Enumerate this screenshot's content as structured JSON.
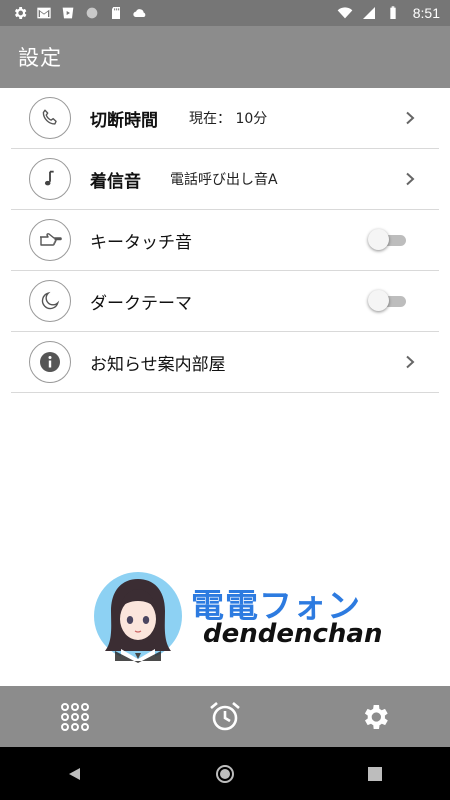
{
  "status_bar": {
    "time": "8:51",
    "left_icons": [
      "settings-icon",
      "gmail-icon",
      "play-icon",
      "circle-icon",
      "sd-card-icon",
      "cloud-icon"
    ],
    "right_icons": [
      "wifi-icon",
      "cellular-icon",
      "battery-icon"
    ]
  },
  "app_bar": {
    "title": "設定"
  },
  "settings": [
    {
      "icon": "phone-icon",
      "label": "切断時間",
      "value": "現在： 10分",
      "control": "chevron"
    },
    {
      "icon": "music-note-icon",
      "label": "着信音",
      "value": "電話呼び出し音A",
      "control": "chevron"
    },
    {
      "icon": "pointing-hand-icon",
      "label": "キータッチ音",
      "control": "toggle",
      "enabled": false
    },
    {
      "icon": "moon-icon",
      "label": "ダークテーマ",
      "control": "toggle",
      "enabled": false
    },
    {
      "icon": "info-icon",
      "label": "お知らせ案内部屋",
      "control": "chevron"
    }
  ],
  "logo": {
    "title": "電電フォン",
    "subtitle": "dendenchan"
  },
  "bottom_bar": {
    "items": [
      "keypad-icon",
      "alarm-clock-icon",
      "gear-icon"
    ]
  },
  "nav_bar": {
    "items": [
      "back-icon",
      "home-icon",
      "recents-icon"
    ]
  },
  "colors": {
    "app_bar": "#8c8c8c",
    "status_bar": "#767676",
    "logo_blue": "#2d7be0",
    "divider": "#d9d9d9"
  }
}
